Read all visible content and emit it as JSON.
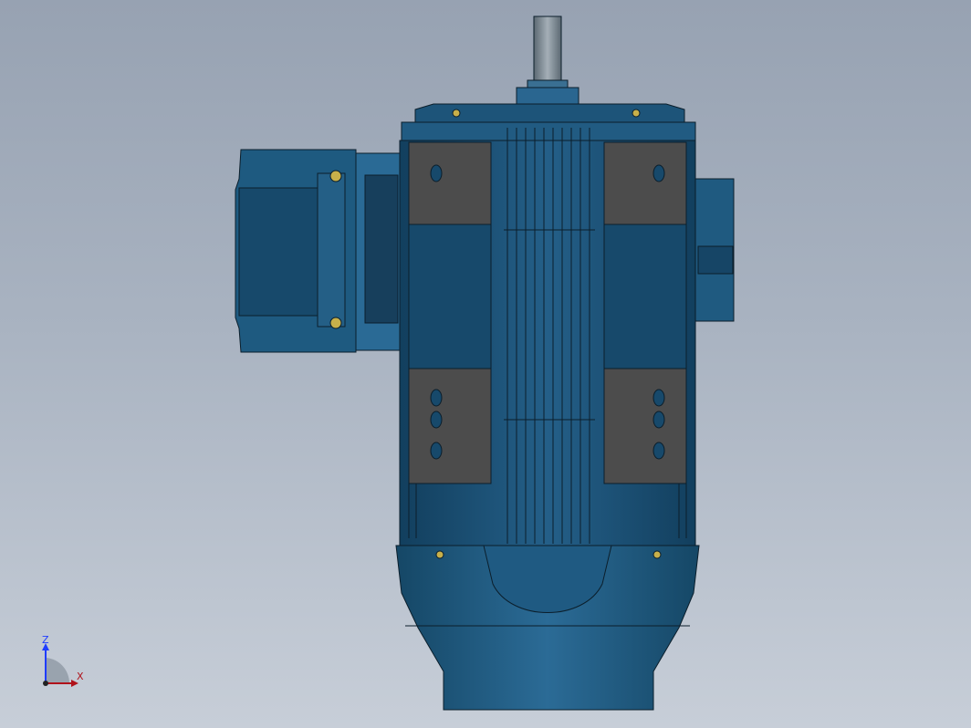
{
  "viewport": {
    "background_top": "#97a2b2",
    "background_bottom": "#c7ced8",
    "model_colors": {
      "body": "#1f5b82",
      "body_dark": "#0f3d5c",
      "body_light": "#2d6f99",
      "pad_gray": "#4c4c4c",
      "shaft": "#7d8b95",
      "outline": "#0b1e2b"
    }
  },
  "triad": {
    "z_label": "Z",
    "x_label": "X",
    "z_color": "#1f3cff",
    "x_color": "#b0121b"
  }
}
